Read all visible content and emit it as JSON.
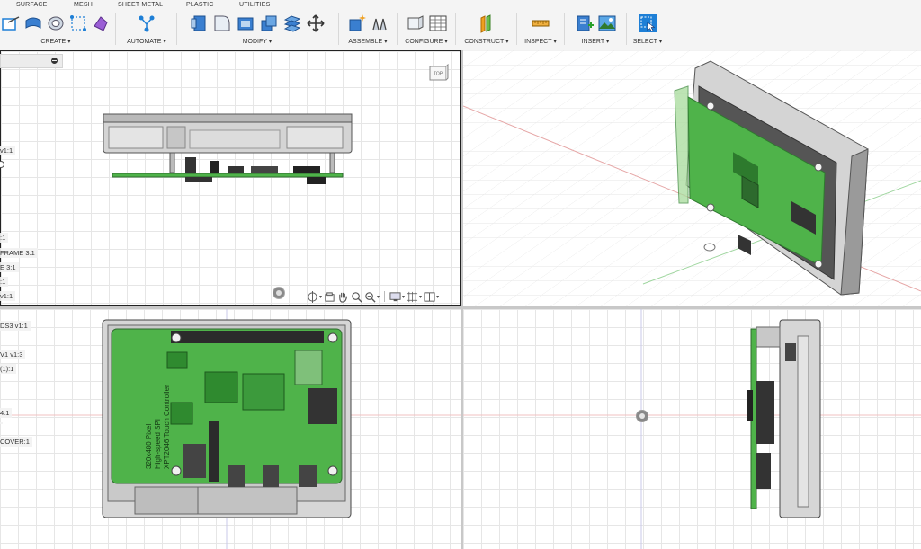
{
  "ribbon": {
    "tabs": [
      "SURFACE",
      "MESH",
      "SHEET METAL",
      "PLASTIC",
      "UTILITIES"
    ],
    "groups": {
      "create": "CREATE ▾",
      "automate": "AUTOMATE ▾",
      "modify": "MODIFY ▾",
      "assemble": "ASSEMBLE ▾",
      "configure": "CONFIGURE ▾",
      "construct": "CONSTRUCT ▾",
      "inspect": "INSPECT ▾",
      "insert": "INSERT ▾",
      "select": "SELECT ▾"
    }
  },
  "browser": {
    "items": [
      "v1:1",
      ":1",
      "FRAME 3:1",
      "E 3:1",
      ":1",
      "v1:1",
      "DS3 v1:1",
      "V1 v1:3",
      "(1):1",
      "4:1",
      "",
      "COVER:1"
    ]
  },
  "viewcube": {
    "label": "TOP"
  },
  "board_text": {
    "line1": "320x480 Pixel",
    "line2": "High-speed SPI",
    "line3": "XPT2046 Touch Controller"
  },
  "colors": {
    "pcb": "#4fb34a",
    "pcb_dark": "#2f8a2f",
    "case": "#c8c8c8",
    "case_dark": "#8c8c8c",
    "accent": "#1e7fd6"
  },
  "icons": {
    "create": [
      "sketch-icon",
      "extrude-icon",
      "revolve-icon",
      "sweep-icon",
      "form-icon"
    ],
    "automate": [
      "automate-icon"
    ],
    "modify": [
      "press-pull-icon",
      "fillet-icon",
      "shell-icon",
      "combine-icon",
      "offset-face-icon",
      "move-icon"
    ],
    "assemble": [
      "new-component-icon",
      "joint-icon"
    ],
    "configure": [
      "configure-icon",
      "table-icon"
    ],
    "construct": [
      "plane-icon"
    ],
    "inspect": [
      "measure-icon"
    ],
    "insert": [
      "insert-mesh-icon",
      "insert-image-icon"
    ],
    "select": [
      "select-icon"
    ]
  }
}
